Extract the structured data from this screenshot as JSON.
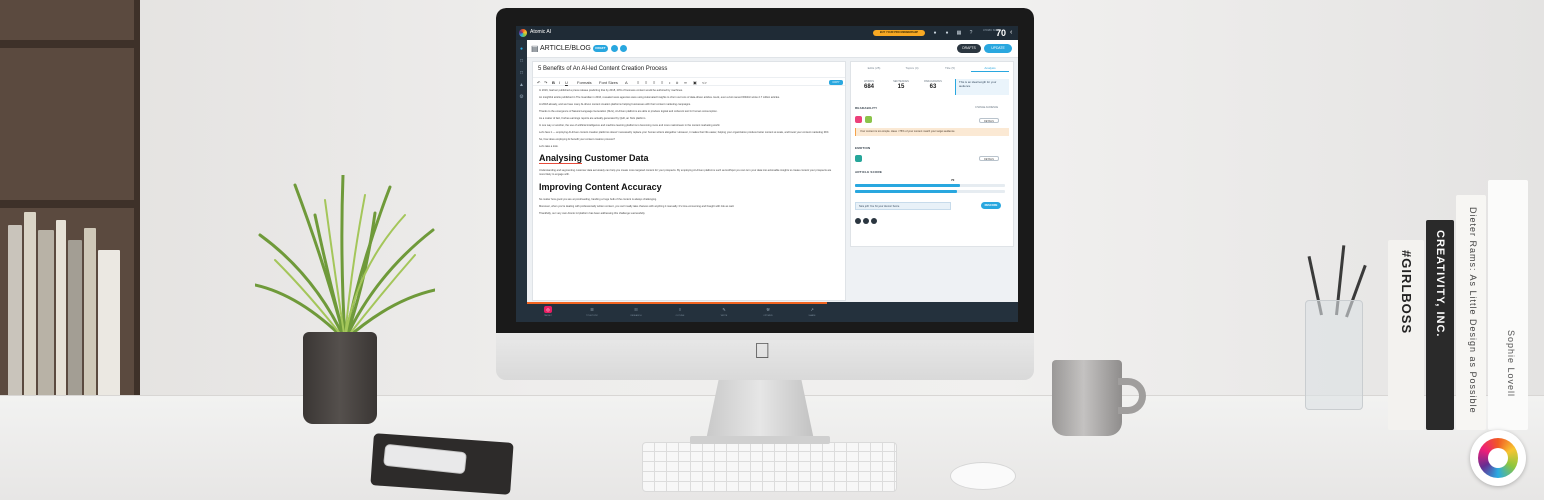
{
  "app": {
    "brand": "Atomic AI",
    "upgrade_label": "BUY YOUR PRO MEMBERSHIP",
    "score_label": "ATOMIC SCORE",
    "score_value": "70",
    "doc_type": "ARTICLE/BLOG",
    "mode_label": "DRAFT",
    "drafts_label": "DRAFTS",
    "update_label": "UPDATE"
  },
  "editor": {
    "title": "5 Benefits of An AI-led Content Creation Process",
    "toolbar": {
      "formats": "Formats",
      "font_sizes": "Font Sizes",
      "copy_label": "COPY"
    },
    "paragraphs_top": [
      "In 2016, Gartner published a press release predicting that by 2018, 20% of business content would be authored by machines.",
      "An insightful article published in The Guardian in 2016, revealed news agencies were using Automated Insights to churn out tons of data-driven articles. Heck, even a bot named Wibbitz wrote 2.7 million articles.",
      "At 2018 already, and we have many AI-driven content creation platforms helping businesses with their content marketing campaigns.",
      "Thanks to the emergence of Natural Language Generation (NLG), AI-driven platforms are able to produce logical and coherent text for human consumption.",
      "As a matter of fact, Forbes earnings reports are actually generated by Quill, an NLG platform.",
      "In one way or another, the use of artificial intelligence and machine learning platforms is becoming more and more mainstream in the content marketing world.",
      "Let's face it — employing AI-driven content creation platforms doesn't necessarily replace your human writers altogether. However, it makes their life easier, helping your organization produce better content at scale, and boost your content marketing ROI.",
      "So, how does employing AI benefit your content creation process?",
      "Let's take a look."
    ],
    "heading_1_word": "Analysing",
    "heading_1_rest": " Customer Data",
    "paragraphs_mid": [
      "Understanding and segmenting customer data accurately can help you create more targeted content for your prospects. By employing AI-driven platforms such as HubSpot you can turn your data into actionable insights to create content your prospects are more likely to engage with."
    ],
    "heading_2": "Improving Content Accuracy",
    "paragraphs_bottom": [
      "No matter how good you are at proofreading, handing a huge bulk of the content is always challenging.",
      "Moreover, when you're dealing with professionally written content, you can't really take chances with anything it manually. It's time-consuming and fraught with risk as well.",
      "Thankfully, our very own Atomic AI platform has been addressing this challenge successfully."
    ]
  },
  "panel": {
    "tabs": [
      "Edits (25)",
      "Topics (4)",
      "Title (5)",
      "Analysis"
    ],
    "active_tab_index": 3,
    "stats": [
      {
        "label": "WORDS",
        "value": "684"
      },
      {
        "label": "SENTENCES",
        "value": "15"
      },
      {
        "label": "PARAGRAPHS",
        "value": "63"
      }
    ],
    "ideal_note": "This is an ideal length for your audience",
    "readability_label": "READABILITY",
    "change_audience": "CHANGE AUDIENCE",
    "details_label": "DETAILS",
    "readability_warning": "Your content is too simple. Have <75% of your content match your target audience",
    "emotion_label": "EMOTION",
    "article_score_label": "ARTICLE SCORE",
    "score_fraction": 0.7,
    "score_text": "70",
    "nice_job": "Nice job! You hit your Atomic Score",
    "rescore_label": "RESCORE"
  },
  "steps": [
    {
      "label": "TARGET",
      "icon": "target-icon"
    },
    {
      "label": "TITLE/TOPIC",
      "icon": "title-icon"
    },
    {
      "label": "RESEARCH",
      "icon": "research-icon"
    },
    {
      "label": "OUTLINE",
      "icon": "outline-icon"
    },
    {
      "label": "WRITE",
      "icon": "write-icon"
    },
    {
      "label": "OPTIMIZE",
      "icon": "optimize-icon"
    },
    {
      "label": "SHARE",
      "icon": "share-icon"
    }
  ],
  "books": {
    "spine_1": "CREATIVITY, INC.",
    "spine_2": "#GIRLBOSS",
    "spine_3": "Dieter Rams: As Little Design as Possible",
    "spine_4": "Sophie Lovell"
  },
  "colors": {
    "accent": "#29a7df",
    "nav": "#24313d",
    "warning": "#f5a34a",
    "upgrade": "#f7a823"
  }
}
